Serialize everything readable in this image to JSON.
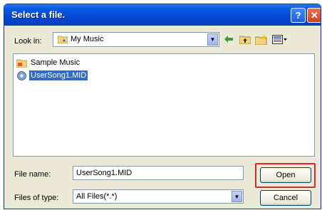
{
  "window": {
    "title": "Select a file.",
    "help_glyph": "?",
    "close_glyph": "✕"
  },
  "lookin": {
    "label": "Look in:",
    "value": "My Music"
  },
  "toolbar": {
    "icons": [
      "back-arrow-icon",
      "up-folder-icon",
      "new-folder-icon",
      "views-menu-icon"
    ]
  },
  "files": [
    {
      "name": "Sample Music",
      "icon": "folder-icon",
      "selected": false
    },
    {
      "name": "UserSong1.MID",
      "icon": "midi-file-icon",
      "selected": true
    }
  ],
  "filename": {
    "label": "File name:",
    "value": "UserSong1.MID"
  },
  "filetype": {
    "label": "Files of type:",
    "value": "All Files(*.*)"
  },
  "buttons": {
    "open": "Open",
    "cancel": "Cancel"
  },
  "colors": {
    "titlebar": "#0648d4",
    "selection": "#316ac5",
    "highlight_box": "#d42a2a"
  }
}
